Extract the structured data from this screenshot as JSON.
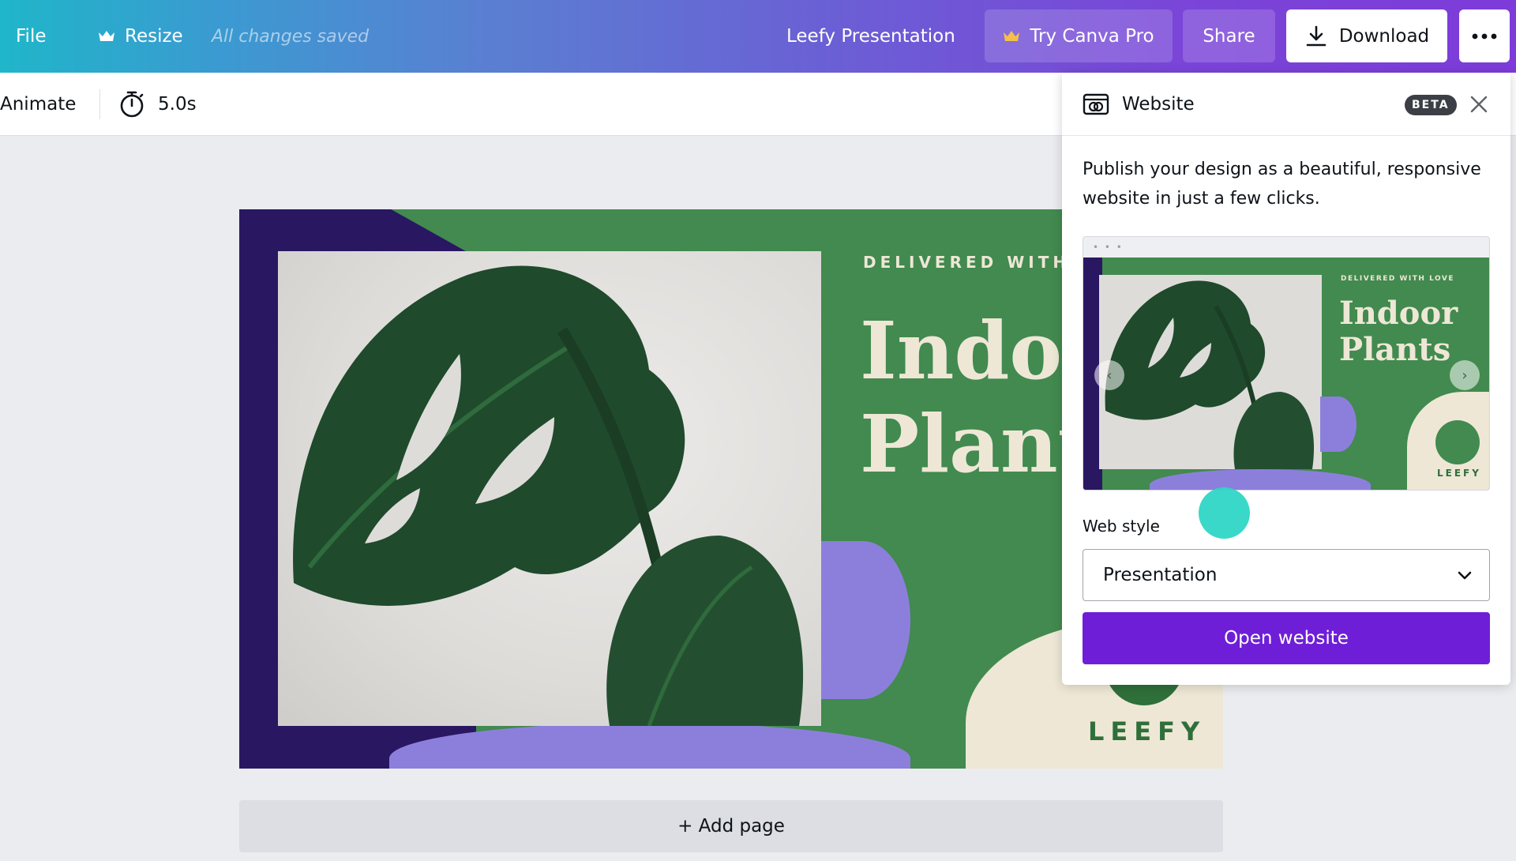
{
  "topbar": {
    "file_label": "File",
    "resize_label": "Resize",
    "save_status": "All changes saved",
    "document_title": "Leefy Presentation",
    "pro_label": "Try Canva Pro",
    "share_label": "Share",
    "download_label": "Download",
    "more_icon": "more-horizontal-icon",
    "crown_color": "#f5c04a"
  },
  "toolbar": {
    "animate_label": "Animate",
    "duration": "5.0s"
  },
  "slide": {
    "subtitle": "DELIVERED WITH",
    "title_line1": "Indoo",
    "title_line2": "Plant",
    "brand": "LEEFY",
    "colors": {
      "green": "#428a4f",
      "purple": "#2a1762",
      "lavender": "#8c7fdc",
      "cream": "#eee7d6"
    }
  },
  "add_page_label": "+ Add page",
  "website_panel": {
    "title": "Website",
    "badge": "BETA",
    "description": "Publish your design as a beautiful, responsive website in just a few clicks.",
    "preview": {
      "dots": "• • •",
      "subtitle": "DELIVERED WITH LOVE",
      "title_line1": "Indoor",
      "title_line2": "Plants",
      "brand": "LEEFY",
      "prev_arrow": "‹",
      "next_arrow": "›"
    },
    "web_style_label": "Web style",
    "web_style_value": "Presentation",
    "open_button_label": "Open website",
    "accent_color": "#6f1ed8"
  }
}
